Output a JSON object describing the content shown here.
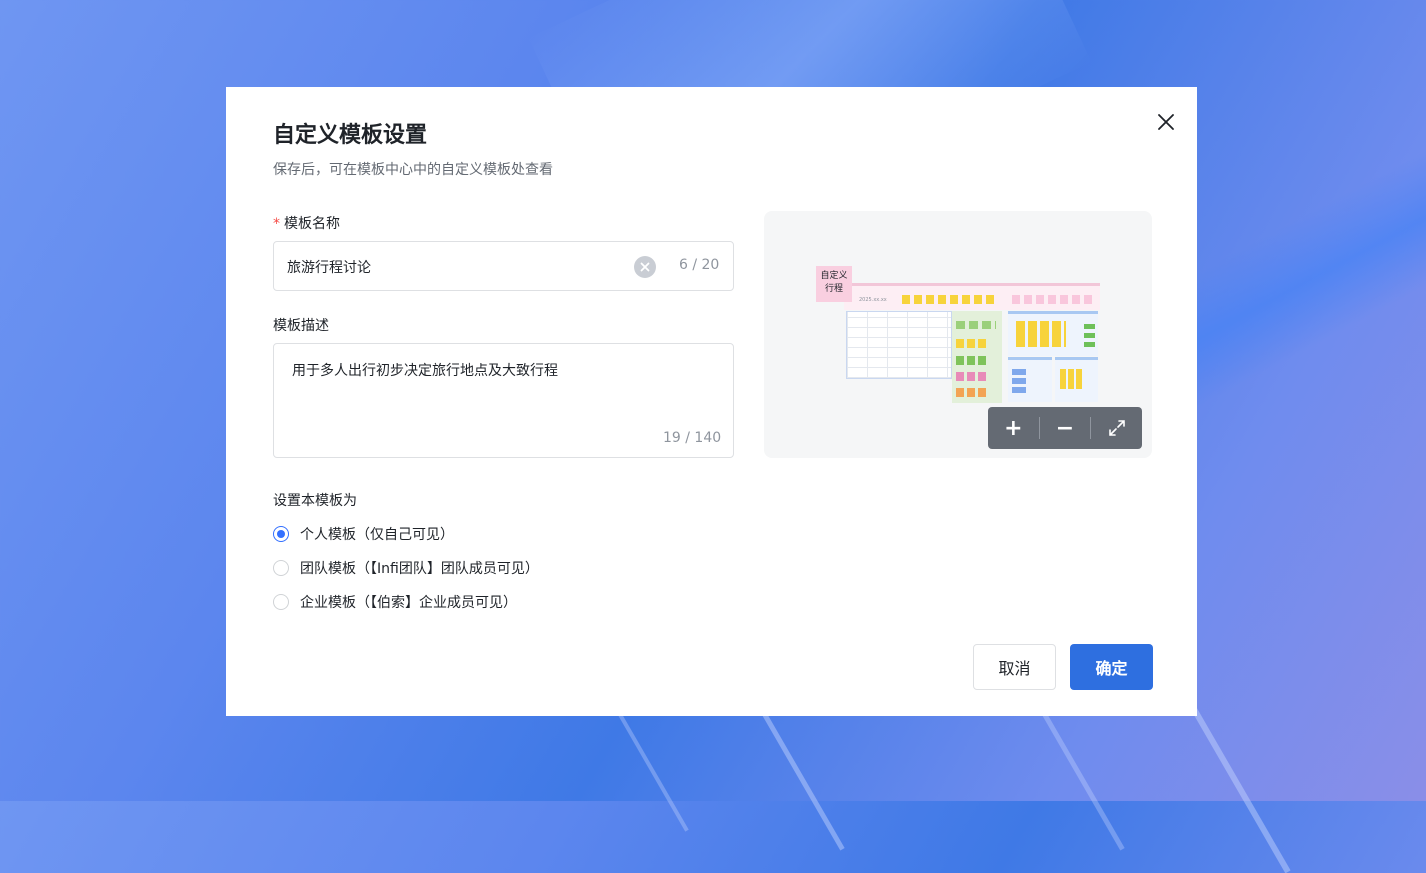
{
  "dialog": {
    "title": "自定义模板设置",
    "subtitle": "保存后，可在模板中心中的自定义模板处查看",
    "name_field": {
      "required_mark": "*",
      "label": "模板名称",
      "value": "旅游行程讨论",
      "counter": "6 / 20"
    },
    "desc_field": {
      "label": "模板描述",
      "value": "用于多人出行初步决定旅行地点及大致行程",
      "counter": "19 / 140"
    },
    "scope": {
      "label": "设置本模板为",
      "options": [
        {
          "label": "个人模板（仅自己可见）",
          "checked": true
        },
        {
          "label": "团队模板（【Infi团队】团队成员可见）",
          "checked": false
        },
        {
          "label": "企业模板（【伯索】企业成员可见）",
          "checked": false
        }
      ]
    },
    "preview": {
      "sticky_text": "自定义\n行程",
      "board_date": "2025.xx.xx",
      "zoom_in": "+",
      "zoom_out": "−"
    },
    "buttons": {
      "cancel": "取消",
      "confirm": "确定"
    }
  },
  "colors": {
    "primary": "#2e6fe0",
    "radio_checked": "#3370ff",
    "required": "#f54a45",
    "sticky_pink": "#f9cfe0",
    "sticky_yellow": "#f7d33b",
    "zoom_bar": "#646a73"
  }
}
